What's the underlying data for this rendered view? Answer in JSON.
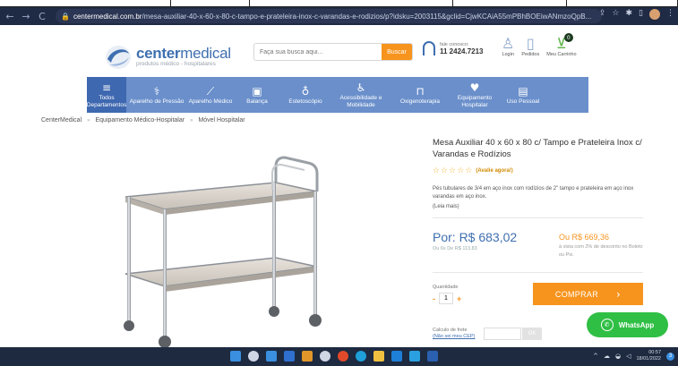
{
  "browser": {
    "url_domain": "centermedical.com.br",
    "url_path": "/mesa-auxiliar-40-x-60-x-80-c-tampo-e-prateleira-inox-c-varandas-e-rodizios/p?idsku=2003115&gclid=CjwKCAiA55mPBhBOEiwANmzoQpB...",
    "nav": {
      "back": "←",
      "forward": "→",
      "reload": "C"
    },
    "icons": [
      "share-icon",
      "star-icon",
      "extension-icon",
      "sidebar-icon",
      "profile-icon",
      "menu-icon"
    ]
  },
  "header": {
    "brand_center": "center",
    "brand_medical": "medical",
    "tagline": "produtos médico - hospitalares",
    "search_placeholder": "Faça sua busca aqui...",
    "search_button": "Buscar",
    "contact_label": "fale conosco:",
    "contact_phone": "11 2424.7213",
    "account": [
      {
        "label": "Login",
        "icon": "user-icon"
      },
      {
        "label": "Pedidos",
        "icon": "clipboard-icon"
      },
      {
        "label": "Meu Carrinho",
        "icon": "cart-icon",
        "badge": "0"
      }
    ]
  },
  "menu": [
    {
      "label": "Todos Departamentos",
      "icon": "hamburger-icon",
      "glyph": "≡"
    },
    {
      "label": "Aparelho de Pressão",
      "icon": "blood-pressure-icon",
      "glyph": "⚕"
    },
    {
      "label": "Aparelho Médico",
      "icon": "medical-device-icon",
      "glyph": "⟋"
    },
    {
      "label": "Balança",
      "icon": "scale-icon",
      "glyph": "▣"
    },
    {
      "label": "Estetoscópio",
      "icon": "stethoscope-icon",
      "glyph": "♁"
    },
    {
      "label": "Acessibilidade e Mobilidade",
      "icon": "wheelchair-icon",
      "glyph": "♿"
    },
    {
      "label": "Oxigenoterapia",
      "icon": "oxygen-icon",
      "glyph": "⊓"
    },
    {
      "label": "Equipamento Hospitalar",
      "icon": "heart-icon",
      "glyph": "♥"
    },
    {
      "label": "Uso Pessoal",
      "icon": "personal-icon",
      "glyph": "▤"
    }
  ],
  "breadcrumb": [
    "CenterMedical",
    "Equipamento Médico-Hospitalar",
    "Móvel Hospitalar"
  ],
  "breadcrumb_sep": "»",
  "product": {
    "title": "Mesa Auxiliar 40 x 60 x 80 c/ Tampo e Prateleira Inox c/ Varandas e Rodízios",
    "stars": "☆☆☆☆☆",
    "rating_link": "(Avalie agora!)",
    "description": "Pés tubulares de 3/4 em aço inox com rodízios de 2\" tampo e prateleira em aço inox varandas em aço inox.",
    "read_more": "(Leia mais)",
    "price": "Por: R$ 683,02",
    "installments": "Ou 6x De R$ 113,83",
    "cash_price": "Ou R$ 669,36",
    "cash_note": "à vista com 2% de desconto no Boleto ou Pix.",
    "qty_label": "Quantidade",
    "qty_minus": "-",
    "qty_value": "1",
    "qty_plus": "+",
    "buy_button": "COMPRAR",
    "buy_arrow": "›",
    "shipping_label": "Calculo de frete",
    "shipping_link": "(Não sei meu CEP)",
    "shipping_button": "OK"
  },
  "whatsapp": "WhatsApp",
  "taskbar": {
    "time": "00:57",
    "date": "18/01/2022",
    "notifications": "3",
    "app_colors": [
      "#3a8fe0",
      "#cfd6e4",
      "#3a8fe0",
      "#2f6fd0",
      "#e2962a",
      "#cfd6e4",
      "#e04a2a",
      "#1fa0d8",
      "#f0c040",
      "#1e7fd8",
      "#2aa0e0",
      "#2b5fb0"
    ]
  },
  "colors": {
    "brand_blue": "#3f6fb0",
    "menu_blue": "#6a8fcb",
    "orange": "#f7941d",
    "whatsapp_green": "#2fbf44"
  }
}
